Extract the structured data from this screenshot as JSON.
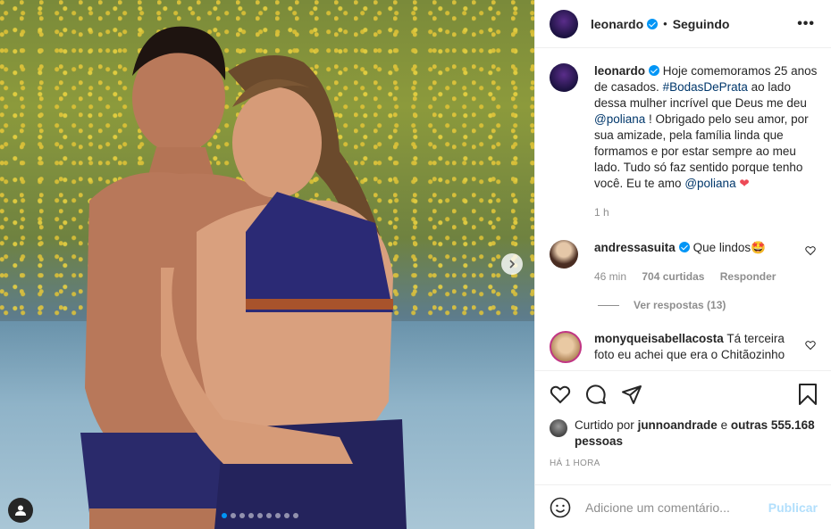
{
  "header": {
    "username": "leonardo",
    "separator": "•",
    "follow_status": "Seguindo",
    "more": "•••"
  },
  "caption": {
    "username": "leonardo",
    "text_1": "Hoje comemoramos 25 anos de casados.",
    "hashtag": "#BodasDePrata",
    "text_2": "ao lado dessa mulher incrível que Deus me deu",
    "mention_1": "@poliana",
    "text_3": "! Obrigado pelo seu amor, por sua amizade, pela família linda que formamos e por estar sempre ao meu lado. Tudo só faz sentido porque tenho você. Eu te amo",
    "mention_2": "@poliana",
    "emoji": "❤",
    "time": "1 h"
  },
  "comments": [
    {
      "username": "andressasuita",
      "text": "Que lindos🤩",
      "time": "46 min",
      "likes": "704 curtidas",
      "reply": "Responder",
      "view_replies": "Ver respostas (13)"
    },
    {
      "username": "monyqueisabellacosta",
      "text": "Tá terceira foto eu achei que era o Chitãozinho"
    }
  ],
  "likes": {
    "prefix": "Curtido por",
    "user": "junnoandrade",
    "conj": "e",
    "others": "outras 555.168 pessoas"
  },
  "timestamp": "HÁ 1 HORA",
  "add_comment": {
    "placeholder": "Adicione um comentário...",
    "publish": "Publicar"
  },
  "carousel": {
    "count": 9,
    "active": 0
  },
  "colors": {
    "accent": "#0095f6",
    "heart": "#ed4956",
    "publish_disabled": "#b2dffc"
  }
}
